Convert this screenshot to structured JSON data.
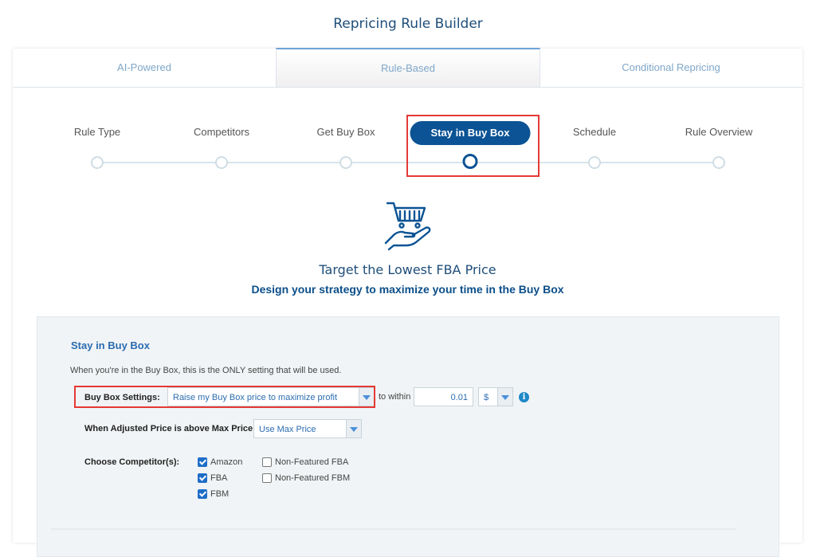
{
  "page": {
    "title": "Repricing Rule Builder"
  },
  "tabs": [
    {
      "label": "AI-Powered",
      "active": false
    },
    {
      "label": "Rule-Based",
      "active": true
    },
    {
      "label": "Conditional Repricing",
      "active": false
    }
  ],
  "steps": [
    {
      "label": "Rule Type",
      "active": false
    },
    {
      "label": "Competitors",
      "active": false
    },
    {
      "label": "Get Buy Box",
      "active": false
    },
    {
      "label": "Stay in Buy Box",
      "active": true
    },
    {
      "label": "Schedule",
      "active": false
    },
    {
      "label": "Rule Overview",
      "active": false
    }
  ],
  "hero": {
    "icon": "cart-in-hand-icon",
    "title": "Target the Lowest FBA Price",
    "subtitle": "Design your strategy to maximize your time in the Buy Box"
  },
  "panel": {
    "title": "Stay in Buy Box",
    "note": "When you're in the Buy Box, this is the ONLY setting that will be used.",
    "buy_box_settings": {
      "label": "Buy Box Settings:",
      "value": "Raise my Buy Box price to maximize profit",
      "within_label": "to within",
      "amount": "0.01",
      "unit": "$"
    },
    "max_price": {
      "label": "When Adjusted Price is above Max Price:",
      "value": "Use Max Price"
    },
    "competitors": {
      "label": "Choose Competitor(s):",
      "options": [
        {
          "label": "Amazon",
          "checked": true
        },
        {
          "label": "FBA",
          "checked": true
        },
        {
          "label": "FBM",
          "checked": true
        },
        {
          "label": "Non-Featured FBA",
          "checked": false
        },
        {
          "label": "Non-Featured FBM",
          "checked": false
        }
      ]
    }
  },
  "colors": {
    "primary": "#0b5394",
    "highlight": "#e53935",
    "link": "#2b6cb0"
  }
}
